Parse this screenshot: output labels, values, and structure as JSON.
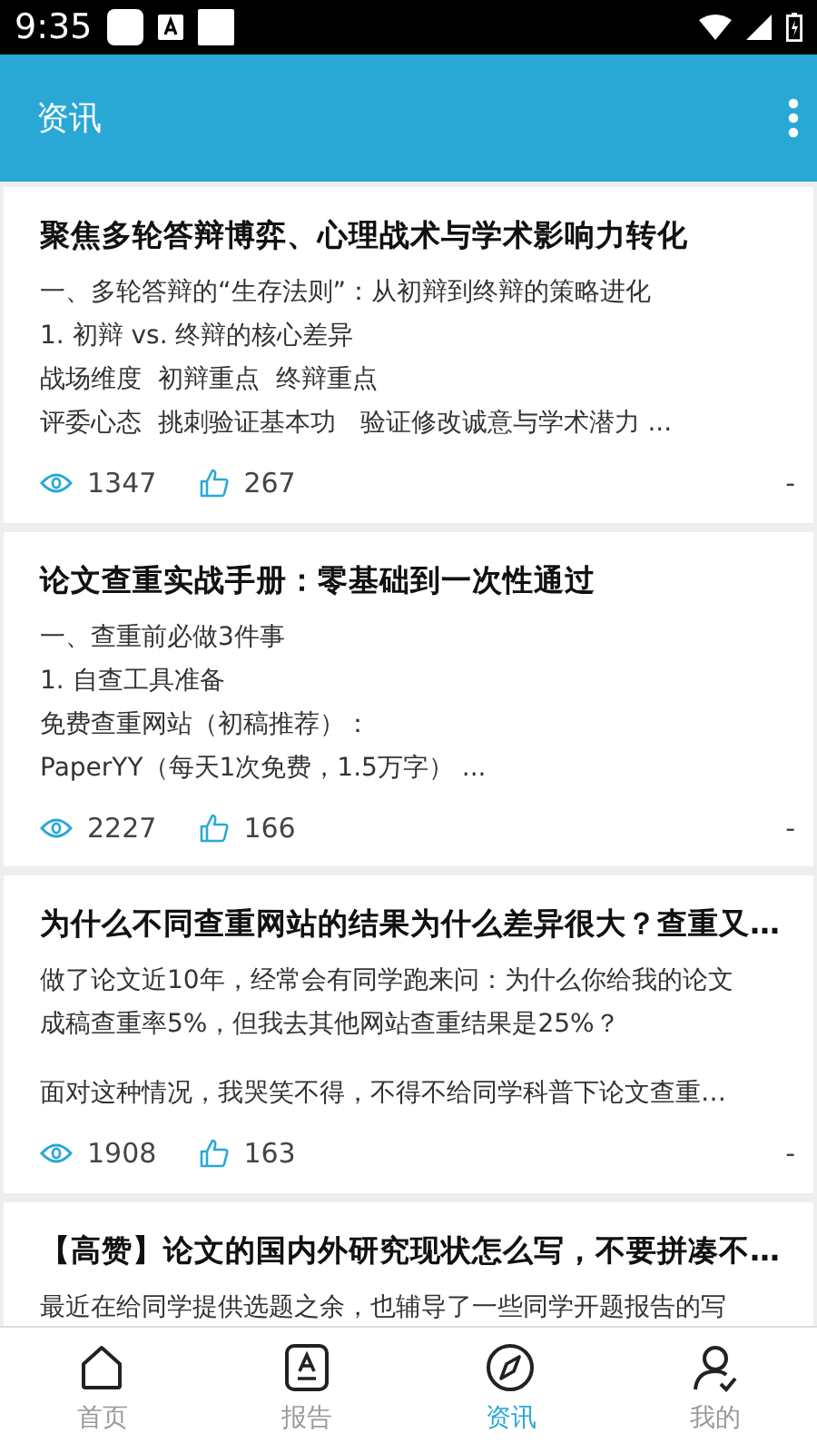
{
  "status_bar": {
    "time": "9:35"
  },
  "app_bar": {
    "title": "资讯"
  },
  "articles": [
    {
      "title": "聚焦多轮答辩博弈、心理战术与学术影响力转化",
      "paragraphs": [
        [
          "一、多轮答辩的“生存法则”：从初辩到终辩的策略进化",
          "1. 初辩 vs. 终辩的核心差异",
          "战场维度  初辩重点  终辩重点",
          "评委心态  挑刺验证基本功   验证修改诚意与学术潜力 ..."
        ]
      ],
      "views": "1347",
      "likes": "267",
      "date": "-"
    },
    {
      "title": "论文查重实战手册：零基础到一次性通过",
      "paragraphs": [
        [
          "一、查重前必做3件事",
          "1. 自查工具准备",
          "免费查重网站（初稿推荐）：",
          "PaperYY（每天1次免费，1.5万字） ..."
        ]
      ],
      "views": "2227",
      "likes": "166",
      "date": "-"
    },
    {
      "title": "为什么不同查重网站的结果为什么差异很大？查重又…",
      "paragraphs": [
        [
          "做了论文近10年，经常会有同学跑来问：为什么你给我的论文",
          "成稿查重率5%，但我去其他网站查重结果是25%？"
        ],
        [
          "面对这种情况，我哭笑不得，不得不给同学科普下论文查重…"
        ]
      ],
      "views": "1908",
      "likes": "163",
      "date": "-"
    },
    {
      "title": "【高赞】论文的国内外研究现状怎么写，不要拼凑不…",
      "paragraphs": [
        [
          "最近在给同学提供选题之余，也辅导了一些同学开题报告的写"
        ]
      ]
    }
  ],
  "bottom_nav": [
    {
      "label": "首页",
      "selected": false
    },
    {
      "label": "报告",
      "selected": false
    },
    {
      "label": "资讯",
      "selected": true
    },
    {
      "label": "我的",
      "selected": false
    }
  ]
}
